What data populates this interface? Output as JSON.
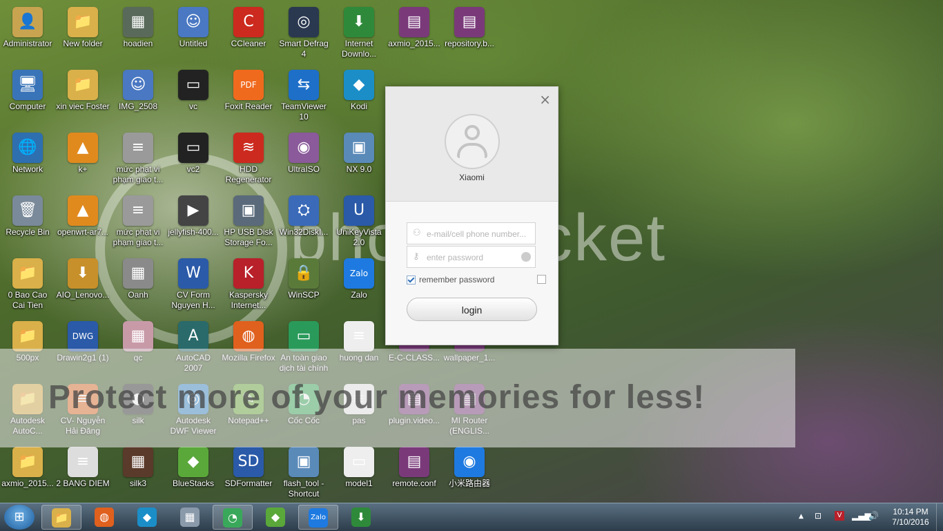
{
  "desktop": {
    "icons": [
      {
        "label": "Administrator",
        "glyph": "👤",
        "color": "#c8a450",
        "col": 0,
        "row": 0
      },
      {
        "label": "New folder",
        "glyph": "📁",
        "color": "#d9b04a",
        "col": 1,
        "row": 0
      },
      {
        "label": "hoadien",
        "glyph": "▦",
        "color": "#5a6a5a",
        "col": 2,
        "row": 0
      },
      {
        "label": "Untitled",
        "glyph": "☺",
        "color": "#4a78c2",
        "col": 3,
        "row": 0
      },
      {
        "label": "CCleaner",
        "glyph": "C",
        "color": "#cc2a1e",
        "col": 4,
        "row": 0
      },
      {
        "label": "Smart Defrag 4",
        "glyph": "◎",
        "color": "#2a3850",
        "col": 5,
        "row": 0
      },
      {
        "label": "Internet Downlo...",
        "glyph": "⬇",
        "color": "#2e8a3a",
        "col": 6,
        "row": 0
      },
      {
        "label": "axmio_2015...",
        "glyph": "▤",
        "color": "#7a3a7a",
        "col": 7,
        "row": 0
      },
      {
        "label": "repository.b...",
        "glyph": "▤",
        "color": "#7a3a7a",
        "col": 8,
        "row": 0
      },
      {
        "label": "Computer",
        "glyph": "🖥",
        "color": "#3a74b8",
        "col": 0,
        "row": 1
      },
      {
        "label": "xin viec Foster",
        "glyph": "📁",
        "color": "#d9b04a",
        "col": 1,
        "row": 1
      },
      {
        "label": "IMG_2508",
        "glyph": "☺",
        "color": "#4a78c2",
        "col": 2,
        "row": 1
      },
      {
        "label": "vc",
        "glyph": "▭",
        "color": "#222222",
        "col": 3,
        "row": 1
      },
      {
        "label": "Foxit Reader",
        "glyph": "PDF",
        "color": "#f06a1e",
        "col": 4,
        "row": 1
      },
      {
        "label": "TeamViewer 10",
        "glyph": "⇆",
        "color": "#1e6fc8",
        "col": 5,
        "row": 1
      },
      {
        "label": "Kodi",
        "glyph": "◆",
        "color": "#1b8ec8",
        "col": 6,
        "row": 1
      },
      {
        "label": "Network",
        "glyph": "🌐",
        "color": "#2e6fb0",
        "col": 0,
        "row": 2
      },
      {
        "label": "k+",
        "glyph": "▲",
        "color": "#e08a1e",
        "col": 1,
        "row": 2
      },
      {
        "label": "mức phạt vi phạm giao t...",
        "glyph": "≡",
        "color": "#9a9a9a",
        "col": 2,
        "row": 2
      },
      {
        "label": "vc2",
        "glyph": "▭",
        "color": "#222222",
        "col": 3,
        "row": 2
      },
      {
        "label": "HDD Regenerator",
        "glyph": "≋",
        "color": "#cc2a1e",
        "col": 4,
        "row": 2
      },
      {
        "label": "UltraISO",
        "glyph": "◉",
        "color": "#8a5a9a",
        "col": 5,
        "row": 2
      },
      {
        "label": "NX 9.0",
        "glyph": "▣",
        "color": "#5a8ab8",
        "col": 6,
        "row": 2
      },
      {
        "label": "Recycle Bin",
        "glyph": "🗑",
        "color": "#7a8a9a",
        "col": 0,
        "row": 3
      },
      {
        "label": "openwrt-ar7...",
        "glyph": "▲",
        "color": "#e08a1e",
        "col": 1,
        "row": 3
      },
      {
        "label": "mức phạt vi phạm giao t...",
        "glyph": "≡",
        "color": "#9a9a9a",
        "col": 2,
        "row": 3
      },
      {
        "label": "jellyfish-400...",
        "glyph": "▶",
        "color": "#444444",
        "col": 3,
        "row": 3
      },
      {
        "label": "HP USB Disk Storage Fo...",
        "glyph": "▣",
        "color": "#5a6a7a",
        "col": 4,
        "row": 3
      },
      {
        "label": "Win32DiskI...",
        "glyph": "⛭",
        "color": "#3a6ab8",
        "col": 5,
        "row": 3
      },
      {
        "label": "UniKeyVista 2.0",
        "glyph": "U",
        "color": "#2a5aa8",
        "col": 6,
        "row": 3
      },
      {
        "label": "0 Bao Cao Cai Tien",
        "glyph": "📁",
        "color": "#d9b04a",
        "col": 0,
        "row": 4
      },
      {
        "label": "AIO_Lenovo...",
        "glyph": "⬇",
        "color": "#c8902a",
        "col": 1,
        "row": 4
      },
      {
        "label": "Oanh",
        "glyph": "▦",
        "color": "#8a8a8a",
        "col": 2,
        "row": 4
      },
      {
        "label": "CV Form Nguyen H...",
        "glyph": "W",
        "color": "#2a5aa8",
        "col": 3,
        "row": 4
      },
      {
        "label": "Kaspersky Internet...",
        "glyph": "K",
        "color": "#b8202a",
        "col": 4,
        "row": 4
      },
      {
        "label": "WinSCP",
        "glyph": "🔒",
        "color": "#5a7a3a",
        "col": 5,
        "row": 4
      },
      {
        "label": "Zalo",
        "glyph": "Zalo",
        "color": "#1e7ae0",
        "col": 6,
        "row": 4
      },
      {
        "label": "500px",
        "glyph": "📁",
        "color": "#d9b04a",
        "col": 0,
        "row": 5
      },
      {
        "label": "Drawin2g1 (1)",
        "glyph": "DWG",
        "color": "#2a5aa8",
        "col": 1,
        "row": 5
      },
      {
        "label": "qc",
        "glyph": "▦",
        "color": "#c89aa8",
        "col": 2,
        "row": 5
      },
      {
        "label": "AutoCAD 2007",
        "glyph": "A",
        "color": "#2a6a6a",
        "col": 3,
        "row": 5
      },
      {
        "label": "Mozilla Firefox",
        "glyph": "◍",
        "color": "#e0601e",
        "col": 4,
        "row": 5
      },
      {
        "label": "An toàn giao dịch tài chính",
        "glyph": "▭",
        "color": "#2a9a5a",
        "col": 5,
        "row": 5
      },
      {
        "label": "huong dan",
        "glyph": "≡",
        "color": "#eeeeee",
        "col": 6,
        "row": 5
      },
      {
        "label": "E-C-CLASS...",
        "glyph": "▤",
        "color": "#7a3a7a",
        "col": 7,
        "row": 5
      },
      {
        "label": "wallpaper_1...",
        "glyph": "▤",
        "color": "#7a3a7a",
        "col": 8,
        "row": 5
      },
      {
        "label": "Autodesk AutoC...",
        "glyph": "📁",
        "color": "#d9b04a",
        "col": 0,
        "row": 6
      },
      {
        "label": "CV- Nguyễn Hải Đăng",
        "glyph": "≡",
        "color": "#e0702a",
        "col": 1,
        "row": 6
      },
      {
        "label": "silk",
        "glyph": "◐",
        "color": "#333333",
        "col": 2,
        "row": 6
      },
      {
        "label": "Autodesk DWF Viewer",
        "glyph": "◎",
        "color": "#3a8ac8",
        "col": 3,
        "row": 6
      },
      {
        "label": "Notepad++",
        "glyph": "✎",
        "color": "#6aa83a",
        "col": 4,
        "row": 6
      },
      {
        "label": "Cốc Cốc",
        "glyph": "◔",
        "color": "#3aa85a",
        "col": 5,
        "row": 6
      },
      {
        "label": "pas",
        "glyph": "≡",
        "color": "#eeeeee",
        "col": 6,
        "row": 6
      },
      {
        "label": "plugin.video...",
        "glyph": "▤",
        "color": "#7a3a7a",
        "col": 7,
        "row": 6
      },
      {
        "label": "MI Router (ENGLIS...",
        "glyph": "▤",
        "color": "#7a3a7a",
        "col": 8,
        "row": 6
      },
      {
        "label": "axmio_2015...",
        "glyph": "📁",
        "color": "#d9b04a",
        "col": 0,
        "row": 7
      },
      {
        "label": "2 BANG DIEM",
        "glyph": "≡",
        "color": "#dddddd",
        "col": 1,
        "row": 7
      },
      {
        "label": "silk3",
        "glyph": "▦",
        "color": "#5a3a2a",
        "col": 2,
        "row": 7
      },
      {
        "label": "BlueStacks",
        "glyph": "◆",
        "color": "#5aa83a",
        "col": 3,
        "row": 7
      },
      {
        "label": "SDFormatter",
        "glyph": "SD",
        "color": "#2a5aa8",
        "col": 4,
        "row": 7
      },
      {
        "label": "flash_tool - Shortcut",
        "glyph": "▣",
        "color": "#5a8ab8",
        "col": 5,
        "row": 7
      },
      {
        "label": "model1",
        "glyph": "▭",
        "color": "#eeeeee",
        "col": 6,
        "row": 7
      },
      {
        "label": "remote.conf",
        "glyph": "▤",
        "color": "#7a3a7a",
        "col": 7,
        "row": 7
      },
      {
        "label": "小米路由器",
        "glyph": "◉",
        "color": "#1e7ae0",
        "col": 8,
        "row": 7
      }
    ]
  },
  "watermark": {
    "logo": "photobucket",
    "tagline": "Protect more of your memories for less!"
  },
  "login_dialog": {
    "close_glyph": "×",
    "account_name": "Xiaomi",
    "email_placeholder": "e-mail/cell phone number...",
    "password_placeholder": "enter password",
    "remember_label": "remember password",
    "remember_checked": true,
    "login_label": "login"
  },
  "taskbar": {
    "start_glyph": "⊞",
    "pinned": [
      {
        "name": "explorer",
        "glyph": "📁",
        "color": "#d9b04a",
        "active": true
      },
      {
        "name": "firefox",
        "glyph": "◍",
        "color": "#e0601e",
        "active": false
      },
      {
        "name": "kodi",
        "glyph": "◆",
        "color": "#1b8ec8",
        "active": false
      },
      {
        "name": "calculator",
        "glyph": "▦",
        "color": "#8a9aaa",
        "active": false
      },
      {
        "name": "coc-coc",
        "glyph": "◔",
        "color": "#3aa85a",
        "active": true
      },
      {
        "name": "bluestacks",
        "glyph": "◆",
        "color": "#5aa83a",
        "active": false
      },
      {
        "name": "zalo",
        "glyph": "Zalo",
        "color": "#1e7ae0",
        "active": true
      },
      {
        "name": "internet-download-manager",
        "glyph": "⬇",
        "color": "#2e8a3a",
        "active": false
      }
    ],
    "clock_time": "10:14 PM",
    "clock_date": "7/10/2016"
  }
}
